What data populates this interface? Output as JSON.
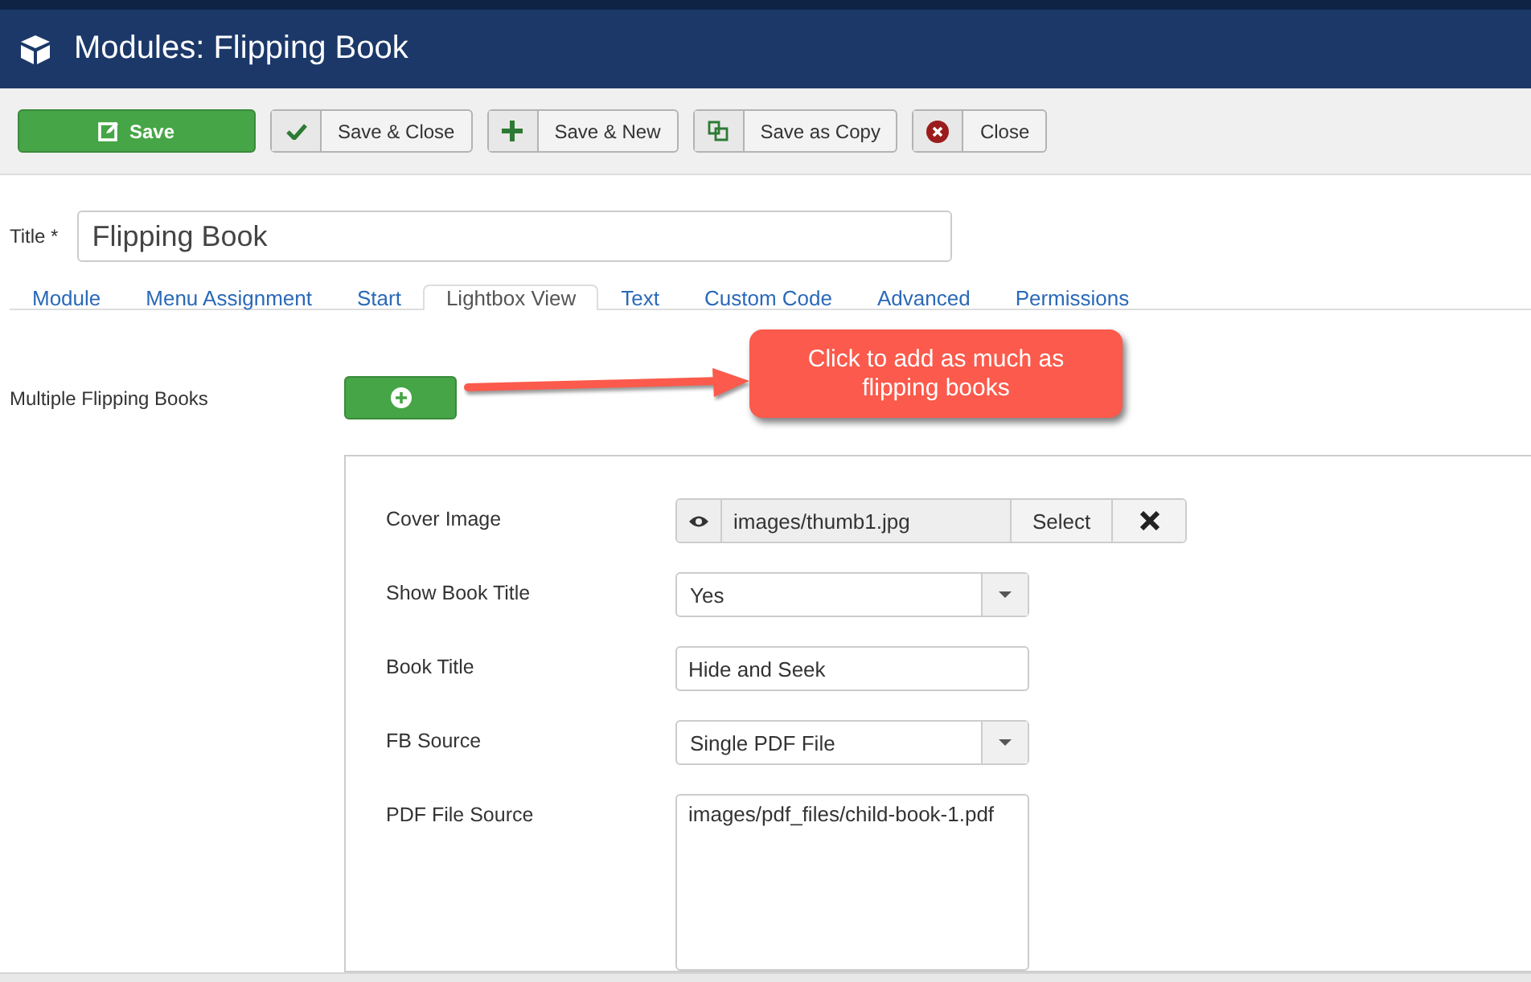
{
  "header": {
    "title": "Modules: Flipping Book"
  },
  "toolbar": [
    {
      "label": "Save",
      "kind": "primary"
    },
    {
      "label": "Save & Close",
      "kind": "default"
    },
    {
      "label": "Save & New",
      "kind": "default"
    },
    {
      "label": "Save as Copy",
      "kind": "default"
    },
    {
      "label": "Close",
      "kind": "default"
    }
  ],
  "title_field": {
    "label": "Title *",
    "value": "Flipping Book"
  },
  "tabs": [
    {
      "label": "Module",
      "selected": false
    },
    {
      "label": "Menu Assignment",
      "selected": false
    },
    {
      "label": "Start",
      "selected": false
    },
    {
      "label": "Lightbox View",
      "selected": true
    },
    {
      "label": "Text",
      "selected": false
    },
    {
      "label": "Custom Code",
      "selected": false
    },
    {
      "label": "Advanced",
      "selected": false
    },
    {
      "label": "Permissions",
      "selected": false
    }
  ],
  "multiple": {
    "label": "Multiple Flipping Books"
  },
  "callout": {
    "text": "Click to add as much as flipping books"
  },
  "fields": [
    {
      "kind": "image",
      "label": "Cover Image",
      "value": "images/thumb1.jpg",
      "button": "Select"
    },
    {
      "kind": "select",
      "label": "Show Book Title",
      "value": "Yes"
    },
    {
      "kind": "text",
      "label": "Book Title",
      "value": "Hide and Seek"
    },
    {
      "kind": "select",
      "label": "FB Source",
      "value": "Single PDF File"
    },
    {
      "kind": "textarea",
      "label": "PDF File Source",
      "value": "images/pdf_files/child-book-1.pdf"
    }
  ]
}
